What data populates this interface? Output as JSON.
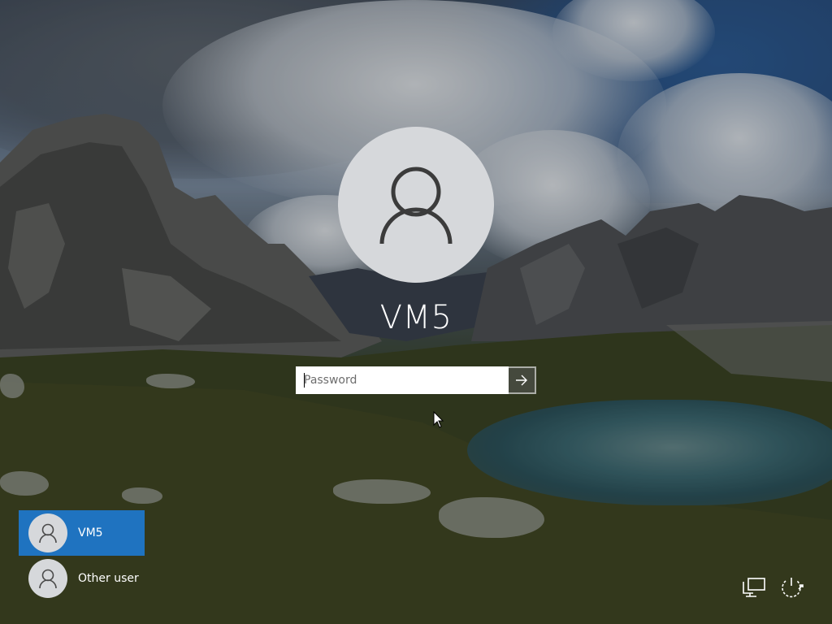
{
  "login": {
    "username": "VM5",
    "password_placeholder": "Password"
  },
  "user_list": [
    {
      "name": "VM5",
      "selected": true
    },
    {
      "name": "Other user",
      "selected": false
    }
  ],
  "icons": {
    "avatar": "person-icon",
    "submit": "arrow-right-icon",
    "network": "network-icon",
    "power": "power-icon"
  },
  "colors": {
    "selected_user": "#1f73c0",
    "avatar_bg": "#d6d8db"
  }
}
